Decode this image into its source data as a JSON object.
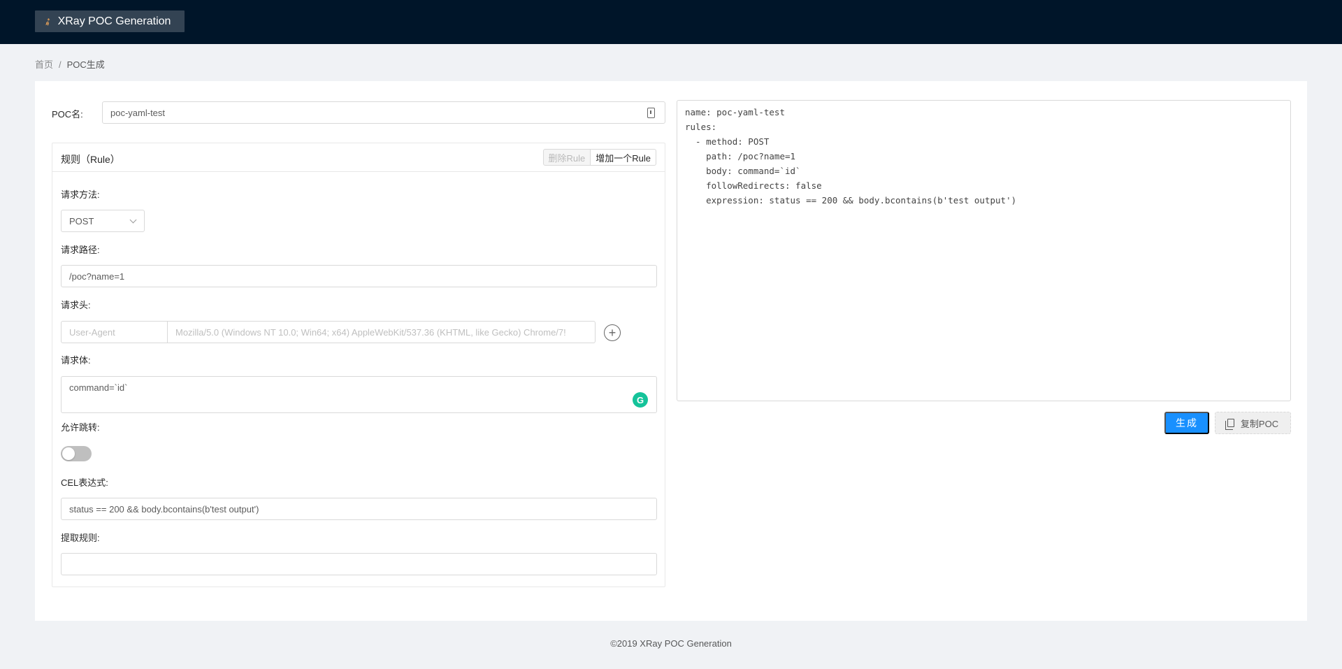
{
  "header": {
    "logo_icon": "rocket-icon",
    "title": "XRay POC Generation"
  },
  "breadcrumb": {
    "home": "首页",
    "separator": "/",
    "current": "POC生成"
  },
  "poc_name": {
    "label": "POC名:",
    "value": "poc-yaml-test"
  },
  "rule": {
    "title": "规则（Rule）",
    "delete_button": "删除Rule",
    "add_button": "增加一个Rule",
    "method": {
      "label": "请求方法:",
      "value": "POST"
    },
    "path": {
      "label": "请求路径:",
      "value": "/poc?name=1"
    },
    "headers": {
      "label": "请求头:",
      "key_placeholder": "User-Agent",
      "value_placeholder": "Mozilla/5.0 (Windows NT 10.0; Win64; x64) AppleWebKit/537.36 (KHTML, like Gecko) Chrome/7!"
    },
    "body": {
      "label": "请求体:",
      "value": "command=`id`"
    },
    "follow_redirects": {
      "label": "允许跳转:",
      "enabled": false
    },
    "expression": {
      "label": "CEL表达式:",
      "value": "status == 200 && body.bcontains(b'test output')"
    },
    "search": {
      "label": "提取规则:",
      "value": ""
    }
  },
  "output": {
    "yaml": "name: poc-yaml-test\nrules:\n  - method: POST\n    path: /poc?name=1\n    body: command=`id`\n    followRedirects: false\n    expression: status == 200 && body.bcontains(b'test output')"
  },
  "actions": {
    "generate": "生成",
    "copy": "复制POC",
    "copy_icon": "copy-icon"
  },
  "footer": {
    "text": "©2019 XRay POC Generation"
  },
  "colors": {
    "header_bg": "#001529",
    "primary": "#1890ff",
    "page_bg": "#f0f2f5"
  }
}
